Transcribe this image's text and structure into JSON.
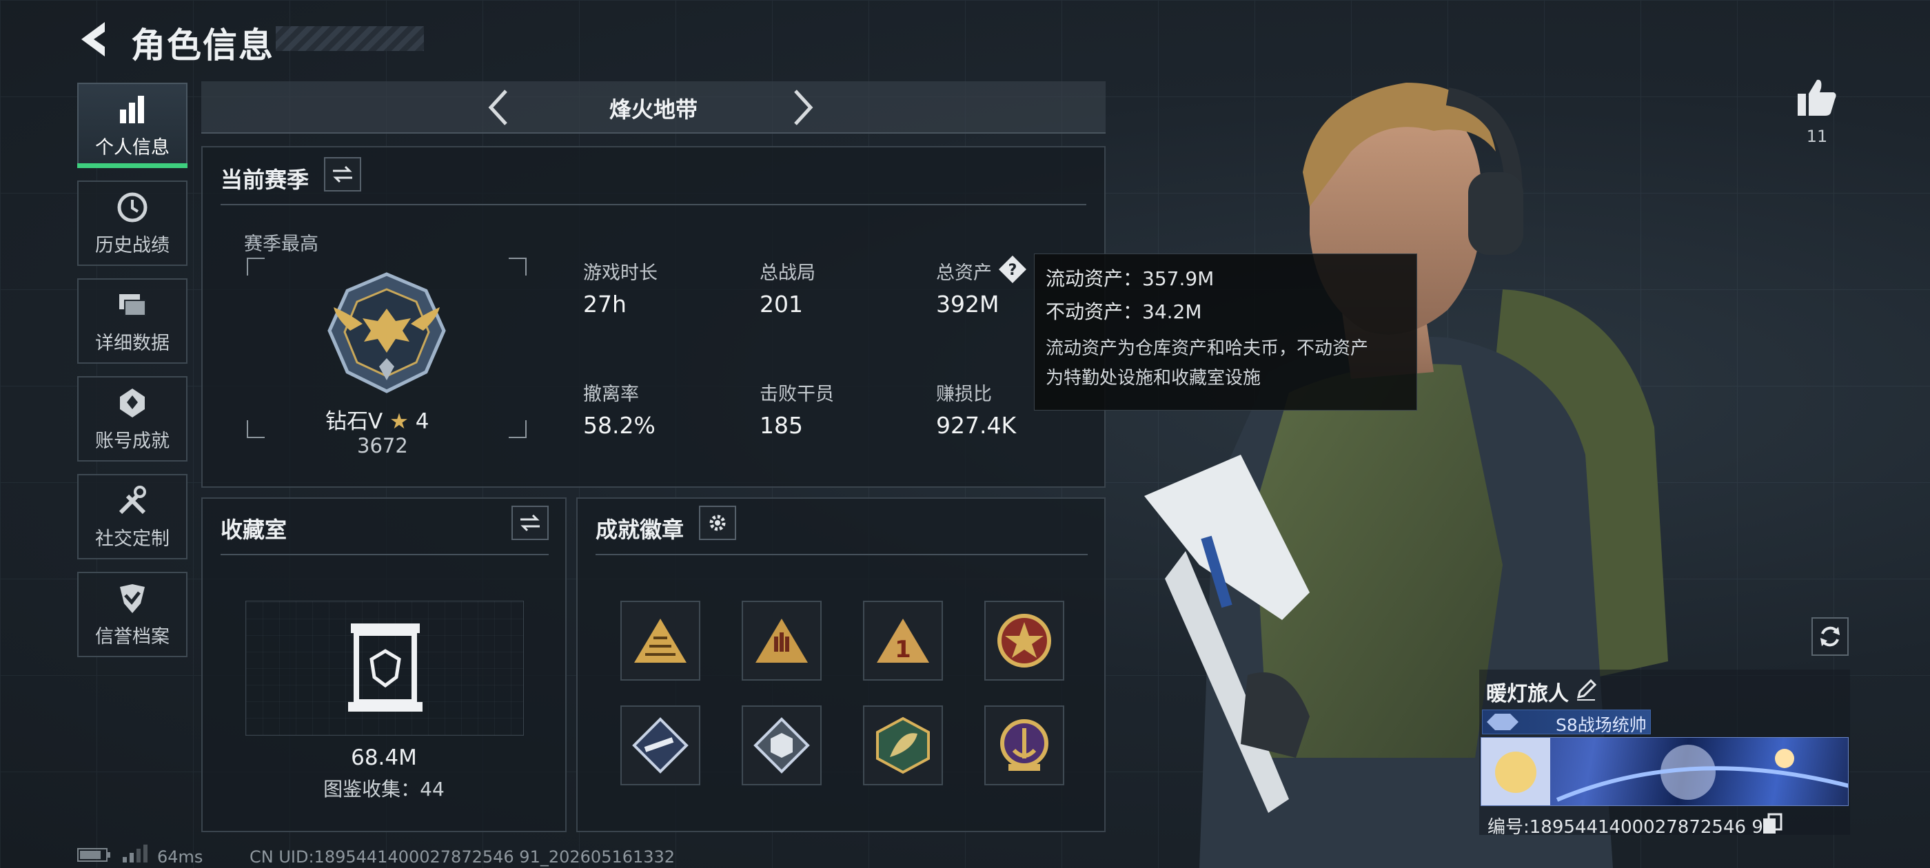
{
  "header": {
    "title": "角色信息"
  },
  "sidebar": {
    "items": [
      {
        "label": "个人信息",
        "icon": "bar-chart-icon",
        "active": true
      },
      {
        "label": "历史战绩",
        "icon": "clock-icon",
        "active": false
      },
      {
        "label": "详细数据",
        "icon": "cards-icon",
        "active": false
      },
      {
        "label": "账号成就",
        "icon": "medal-icon",
        "active": false
      },
      {
        "label": "社交定制",
        "icon": "tools-icon",
        "active": false
      },
      {
        "label": "信誉档案",
        "icon": "shield-check-icon",
        "active": false
      }
    ]
  },
  "mode": {
    "name": "烽火地带"
  },
  "season": {
    "heading": "当前赛季",
    "best_label": "赛季最高",
    "rank_name": "钻石V",
    "rank_stars": "4",
    "rank_score": "3672",
    "stats": [
      {
        "label": "游戏时长",
        "value": "27h"
      },
      {
        "label": "总战局",
        "value": "201"
      },
      {
        "label": "总资产",
        "value": "392M"
      },
      {
        "label": "撤离率",
        "value": "58.2%"
      },
      {
        "label": "击败干员",
        "value": "185"
      },
      {
        "label": "赚损比",
        "value": "927.4K"
      }
    ]
  },
  "tooltip": {
    "liquid": "流动资产：357.9M",
    "fixed": "不动资产：34.2M",
    "desc_line1": "流动资产为仓库资产和哈夫币，不动资产",
    "desc_line2": "为特勤处设施和收藏室设施"
  },
  "collection": {
    "heading": "收藏室",
    "value": "68.4M",
    "catalog": "图鉴收集：44"
  },
  "achievements": {
    "heading": "成就徽章",
    "badges": [
      "pyramid-badge-icon",
      "hand-badge-icon",
      "number-one-badge-icon",
      "star-badge-icon",
      "rocket-badge-icon",
      "cube-badge-icon",
      "leaf-badge-icon",
      "anchor-badge-icon"
    ]
  },
  "likes": {
    "count": "11"
  },
  "profile": {
    "name": "暖灯旅人",
    "title": "S8战场统帅",
    "id_text": "编号:1895441400027872546 91"
  },
  "footer": {
    "ping": "64ms",
    "uid": "CN UID:1895441400027872546 91_202605161332"
  },
  "colors": {
    "accent_green": "#3ecf7e",
    "gold": "#d8b15a"
  }
}
